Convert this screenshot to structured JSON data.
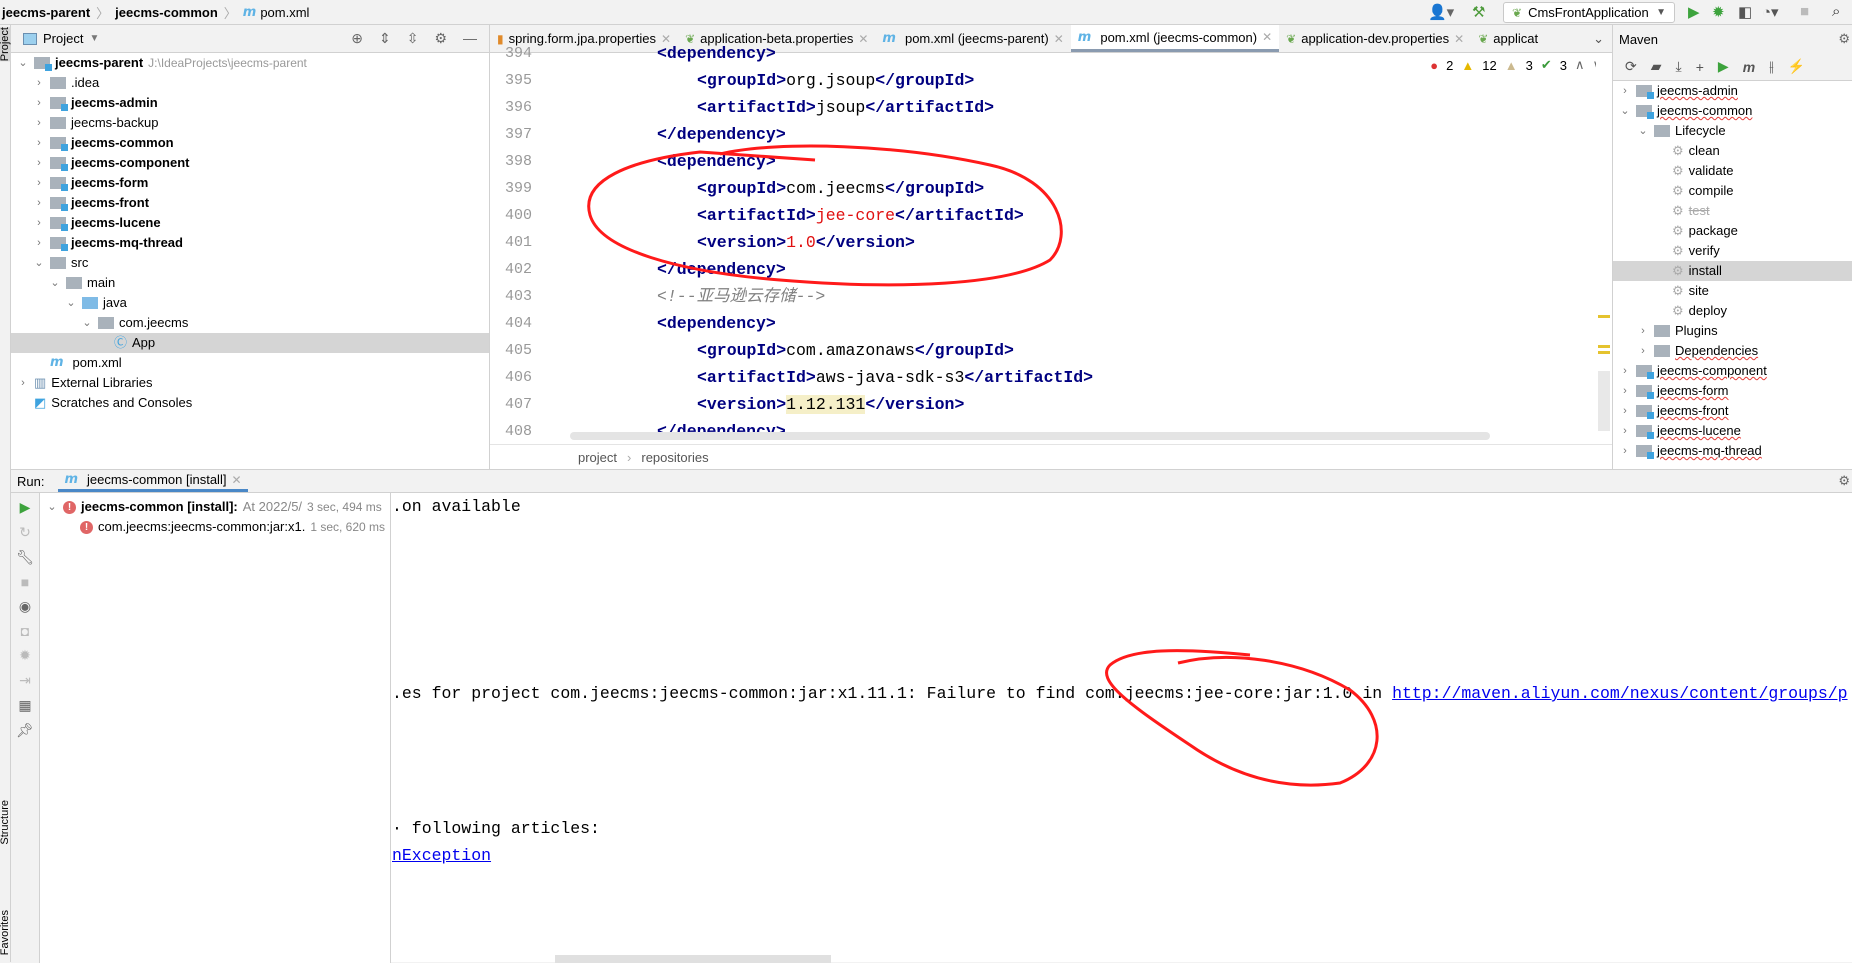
{
  "nav": {
    "crumbs": [
      "jeecms-parent",
      "jeecms-common",
      "pom.xml"
    ],
    "run_config": "CmsFrontApplication"
  },
  "stripe": {
    "project": "Project",
    "structure": "Structure",
    "favorites": "Favorites"
  },
  "project": {
    "title": "Project",
    "tree": [
      {
        "label": "jeecms-parent",
        "path": "J:\\IdeaProjects\\jeecms-parent",
        "bold": true,
        "level": 0,
        "open": true,
        "kind": "module"
      },
      {
        "label": ".idea",
        "level": 1,
        "kind": "folder"
      },
      {
        "label": "jeecms-admin",
        "level": 1,
        "bold": true,
        "kind": "module"
      },
      {
        "label": "jeecms-backup",
        "level": 1,
        "kind": "folder"
      },
      {
        "label": "jeecms-common",
        "level": 1,
        "bold": true,
        "kind": "module"
      },
      {
        "label": "jeecms-component",
        "level": 1,
        "bold": true,
        "kind": "module"
      },
      {
        "label": "jeecms-form",
        "level": 1,
        "bold": true,
        "kind": "module"
      },
      {
        "label": "jeecms-front",
        "level": 1,
        "bold": true,
        "kind": "module"
      },
      {
        "label": "jeecms-lucene",
        "level": 1,
        "bold": true,
        "kind": "module"
      },
      {
        "label": "jeecms-mq-thread",
        "level": 1,
        "bold": true,
        "kind": "module"
      },
      {
        "label": "src",
        "level": 1,
        "open": true,
        "kind": "folder"
      },
      {
        "label": "main",
        "level": 2,
        "open": true,
        "kind": "folder"
      },
      {
        "label": "java",
        "level": 3,
        "open": true,
        "kind": "blue"
      },
      {
        "label": "com.jeecms",
        "level": 4,
        "open": true,
        "kind": "folder"
      },
      {
        "label": "App",
        "level": 5,
        "kind": "class",
        "selected": true
      },
      {
        "label": "pom.xml",
        "level": 1,
        "kind": "pom"
      },
      {
        "label": "External Libraries",
        "level": 0,
        "kind": "lib"
      },
      {
        "label": "Scratches and Consoles",
        "level": 0,
        "kind": "scratch"
      }
    ]
  },
  "editor": {
    "tabs": [
      {
        "label": "spring.form.jpa.properties",
        "icon": "properties"
      },
      {
        "label": "application-beta.properties",
        "icon": "spring"
      },
      {
        "label": "pom.xml (jeecms-parent)",
        "icon": "maven"
      },
      {
        "label": "pom.xml (jeecms-common)",
        "icon": "maven",
        "active": true
      },
      {
        "label": "application-dev.properties",
        "icon": "spring"
      },
      {
        "label": "applicat",
        "icon": "spring"
      }
    ],
    "inspections": {
      "errors": "2",
      "warnings": "12",
      "weak": "3",
      "ok": "3"
    },
    "lines": [
      {
        "n": "394",
        "indent": 2,
        "parts": [
          [
            "tag",
            "<dependency>"
          ]
        ]
      },
      {
        "n": "395",
        "indent": 3,
        "parts": [
          [
            "tag",
            "<groupId>"
          ],
          [
            "t",
            "org.jsoup"
          ],
          [
            "tag",
            "</groupId>"
          ]
        ]
      },
      {
        "n": "396",
        "indent": 3,
        "parts": [
          [
            "tag",
            "<artifactId>"
          ],
          [
            "t",
            "jsoup"
          ],
          [
            "tag",
            "</artifactId>"
          ]
        ]
      },
      {
        "n": "397",
        "indent": 2,
        "parts": [
          [
            "tag",
            "</dependency>"
          ]
        ]
      },
      {
        "n": "398",
        "indent": 2,
        "parts": [
          [
            "tag",
            "<dependency>"
          ]
        ]
      },
      {
        "n": "399",
        "indent": 3,
        "parts": [
          [
            "tag",
            "<groupId>"
          ],
          [
            "t",
            "com.jeecms"
          ],
          [
            "tag",
            "</groupId>"
          ]
        ]
      },
      {
        "n": "400",
        "indent": 3,
        "parts": [
          [
            "tag",
            "<artifactId>"
          ],
          [
            "red",
            "jee-core"
          ],
          [
            "tag",
            "</artifactId>"
          ]
        ]
      },
      {
        "n": "401",
        "indent": 3,
        "parts": [
          [
            "tag",
            "<version>"
          ],
          [
            "red",
            "1.0"
          ],
          [
            "tag",
            "</version>"
          ]
        ]
      },
      {
        "n": "402",
        "indent": 2,
        "parts": [
          [
            "tag",
            "</dependency>"
          ]
        ]
      },
      {
        "n": "403",
        "indent": 2,
        "parts": [
          [
            "cmt",
            "<!--亚马逊云存储-->"
          ]
        ]
      },
      {
        "n": "404",
        "indent": 2,
        "parts": [
          [
            "tag",
            "<dependency>"
          ]
        ]
      },
      {
        "n": "405",
        "indent": 3,
        "parts": [
          [
            "tag",
            "<groupId>"
          ],
          [
            "t",
            "com.amazonaws"
          ],
          [
            "tag",
            "</groupId>"
          ]
        ]
      },
      {
        "n": "406",
        "indent": 3,
        "parts": [
          [
            "tag",
            "<artifactId>"
          ],
          [
            "t",
            "aws-java-sdk-s3"
          ],
          [
            "tag",
            "</artifactId>"
          ]
        ]
      },
      {
        "n": "407",
        "indent": 3,
        "parts": [
          [
            "tag",
            "<version>"
          ],
          [
            "hl",
            "1.12.131"
          ],
          [
            "tag",
            "</version>"
          ]
        ]
      },
      {
        "n": "408",
        "indent": 2,
        "parts": [
          [
            "tag",
            "</dependency>"
          ]
        ]
      }
    ],
    "breadcrumb": [
      "project",
      "repositories"
    ]
  },
  "maven": {
    "title": "Maven",
    "tree": [
      {
        "label": "jeecms-admin",
        "level": 0,
        "kind": "mod"
      },
      {
        "label": "jeecms-common",
        "level": 0,
        "kind": "mod",
        "open": true
      },
      {
        "label": "Lifecycle",
        "level": 1,
        "kind": "folder",
        "open": true
      },
      {
        "label": "clean",
        "level": 2,
        "kind": "goal"
      },
      {
        "label": "validate",
        "level": 2,
        "kind": "goal"
      },
      {
        "label": "compile",
        "level": 2,
        "kind": "goal"
      },
      {
        "label": "test",
        "level": 2,
        "kind": "goal",
        "strike": true
      },
      {
        "label": "package",
        "level": 2,
        "kind": "goal"
      },
      {
        "label": "verify",
        "level": 2,
        "kind": "goal"
      },
      {
        "label": "install",
        "level": 2,
        "kind": "goal",
        "selected": true
      },
      {
        "label": "site",
        "level": 2,
        "kind": "goal"
      },
      {
        "label": "deploy",
        "level": 2,
        "kind": "goal"
      },
      {
        "label": "Plugins",
        "level": 1,
        "kind": "folder"
      },
      {
        "label": "Dependencies",
        "level": 1,
        "kind": "deps"
      },
      {
        "label": "jeecms-component",
        "level": 0,
        "kind": "mod"
      },
      {
        "label": "jeecms-form",
        "level": 0,
        "kind": "mod"
      },
      {
        "label": "jeecms-front",
        "level": 0,
        "kind": "mod"
      },
      {
        "label": "jeecms-lucene",
        "level": 0,
        "kind": "mod"
      },
      {
        "label": "jeecms-mq-thread",
        "level": 0,
        "kind": "mod"
      }
    ]
  },
  "run": {
    "label": "Run:",
    "tab": "jeecms-common [install]",
    "tree": [
      {
        "label": "jeecms-common [install]:",
        "detail": "At 2022/5/",
        "time": "3 sec, 494 ms"
      },
      {
        "label": "com.jeecms:jeecms-common:jar:x1.",
        "time": "1 sec, 620 ms"
      }
    ],
    "console": {
      "line1": ".on available",
      "line2": ".es for project com.jeecms:jeecms-common:jar:x1.11.1: Failure to find com.jeecms:jee-core:jar:1.0 in ",
      "line2_link": "http://maven.aliyun.com/nexus/content/groups/p",
      "line3": "· following articles:",
      "line4_link": "nException"
    }
  },
  "colors": {
    "annotation": "#ff1a1a",
    "accent": "#4a88c7"
  }
}
